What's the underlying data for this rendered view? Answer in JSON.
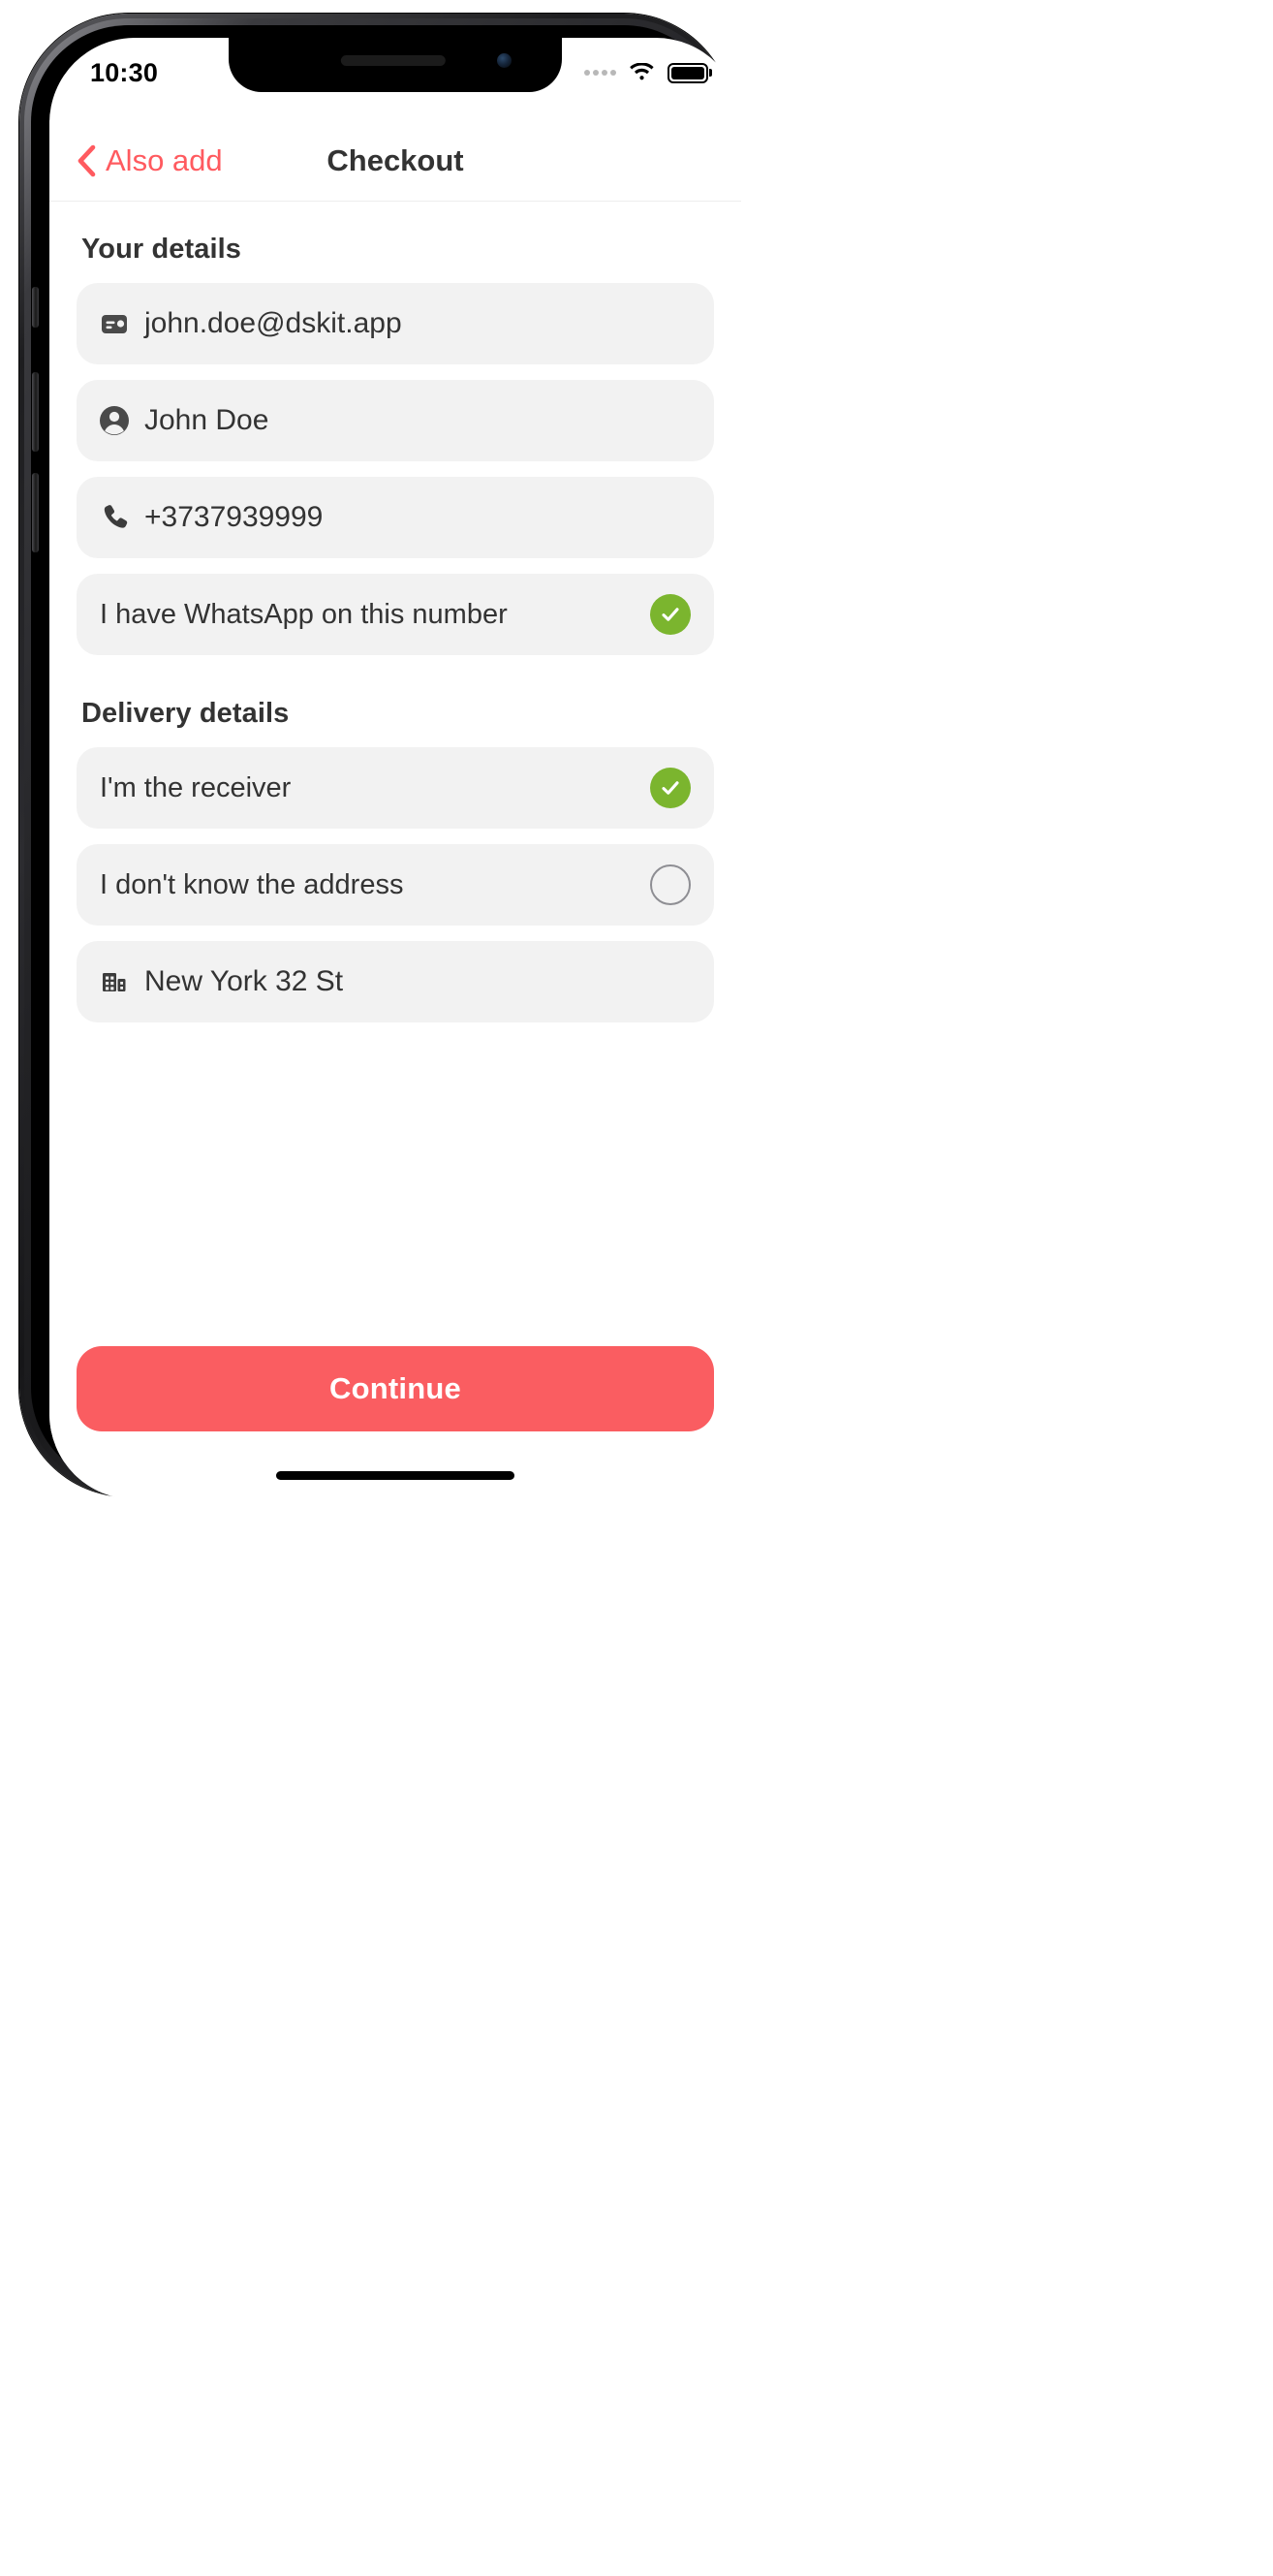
{
  "status_bar": {
    "time": "10:30",
    "signal_icon": "signal-dots-icon",
    "wifi_icon": "wifi-icon",
    "battery_icon": "battery-full-icon"
  },
  "nav": {
    "back_icon": "chevron-left-icon",
    "back_label": "Also add",
    "title": "Checkout"
  },
  "sections": {
    "your_details": {
      "title": "Your details",
      "email": {
        "icon": "contact-card-icon",
        "value": "john.doe@dskit.app"
      },
      "name": {
        "icon": "person-circle-icon",
        "value": "John Doe"
      },
      "phone": {
        "icon": "phone-icon",
        "value": "+3737939999"
      },
      "whatsapp": {
        "label": "I have WhatsApp on this number",
        "checked": "checked",
        "check_icon": "checkmark-icon"
      }
    },
    "delivery_details": {
      "title": "Delivery details",
      "receiver": {
        "label": "I'm the receiver",
        "checked": "checked",
        "check_icon": "checkmark-icon"
      },
      "unknown_address": {
        "label": "I don't know the address",
        "checked": "unchecked",
        "check_icon": "empty-circle-icon"
      },
      "address": {
        "icon": "building-icon",
        "value": "New York 32 St"
      }
    }
  },
  "footer": {
    "continue_label": "Continue",
    "home_indicator": "home-indicator"
  },
  "colors": {
    "accent": "#FF5A5F",
    "cta": "#FA5D61",
    "check_green": "#7BB52E",
    "field_bg": "#F2F2F2",
    "text": "#333333"
  }
}
